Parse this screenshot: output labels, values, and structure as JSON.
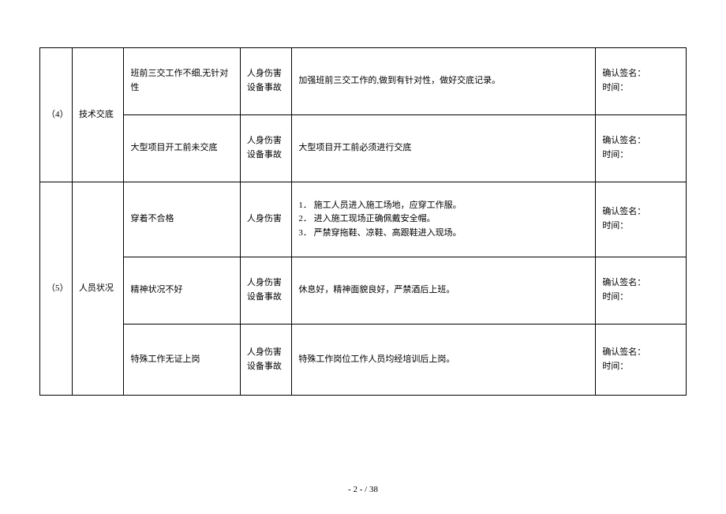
{
  "rows": [
    {
      "num": "（4）",
      "category": "技术交底",
      "sub": [
        {
          "issue": "班前三交工作不细,无针对性",
          "hazard": "人身伤害\n设备事故",
          "measure_single": "加强班前三交工作的,做到有针对性，做好交底记录。",
          "sign": "确认签名：\n时间："
        },
        {
          "issue": "大型项目开工前未交底",
          "hazard": "人身伤害\n设备事故",
          "measure_single": "大型项目开工前必须进行交底",
          "sign": "确认签名：\n时间："
        }
      ]
    },
    {
      "num": "（5）",
      "category": "人员状况",
      "sub": [
        {
          "issue": "穿着不合格",
          "hazard": "人身伤害",
          "measure_list": [
            "1．  施工人员进入施工场地，应穿工作服。",
            "2．  进入施工现场正确佩戴安全帽。",
            "3．  严禁穿拖鞋、凉鞋、高跟鞋进入现场。"
          ],
          "sign": "确认签名：\n时间："
        },
        {
          "issue": "精神状况不好",
          "hazard": "人身伤害\n设备事故",
          "measure_single": "休息好，精神面貌良好，严禁酒后上班。",
          "sign": "确认签名：\n时间："
        },
        {
          "issue": "特殊工作无证上岗",
          "hazard": "人身伤害\n设备事故",
          "measure_single": "特殊工作岗位工作人员均经培训后上岗。",
          "sign": "确认签名：\n时间："
        }
      ]
    }
  ],
  "page": {
    "current": "- 2 -",
    "sep": " / ",
    "total": "38"
  }
}
